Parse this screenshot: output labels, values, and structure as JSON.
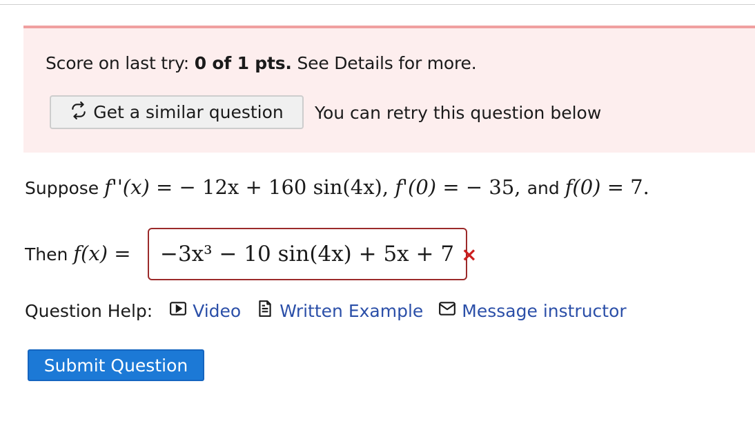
{
  "alert": {
    "score_prefix": "Score on last try: ",
    "score_value": "0 of 1 pts.",
    "score_suffix": " See Details for more.",
    "similar_button_label": "Get a similar question",
    "retry_text": "You can retry this question below"
  },
  "question": {
    "prefix": "Suppose ",
    "fpp": "f''(x)",
    "eq1": " = − 12x + 160 sin(4x), ",
    "fp0": "f'(0)",
    "eq2": " = − 35, ",
    "and": "and ",
    "f0": "f(0)",
    "eq3": " = 7."
  },
  "answer": {
    "then_prefix": "Then ",
    "fx": "f(x)",
    "eq": " =",
    "value": "−3x³ − 10 sin(4x) + 5x + 7",
    "status": "×"
  },
  "help": {
    "label": "Question Help:",
    "links": [
      {
        "label": "Video",
        "icon": "video-icon"
      },
      {
        "label": "Written Example",
        "icon": "document-icon"
      },
      {
        "label": "Message instructor",
        "icon": "mail-icon"
      }
    ],
    "link_color": "#2b4fa8"
  },
  "submit": {
    "label": "Submit Question",
    "color": "#1c79d6"
  },
  "colors": {
    "alert_bg": "#fdeeee",
    "alert_border": "#f0a0a0",
    "error": "#cc1f1f"
  }
}
